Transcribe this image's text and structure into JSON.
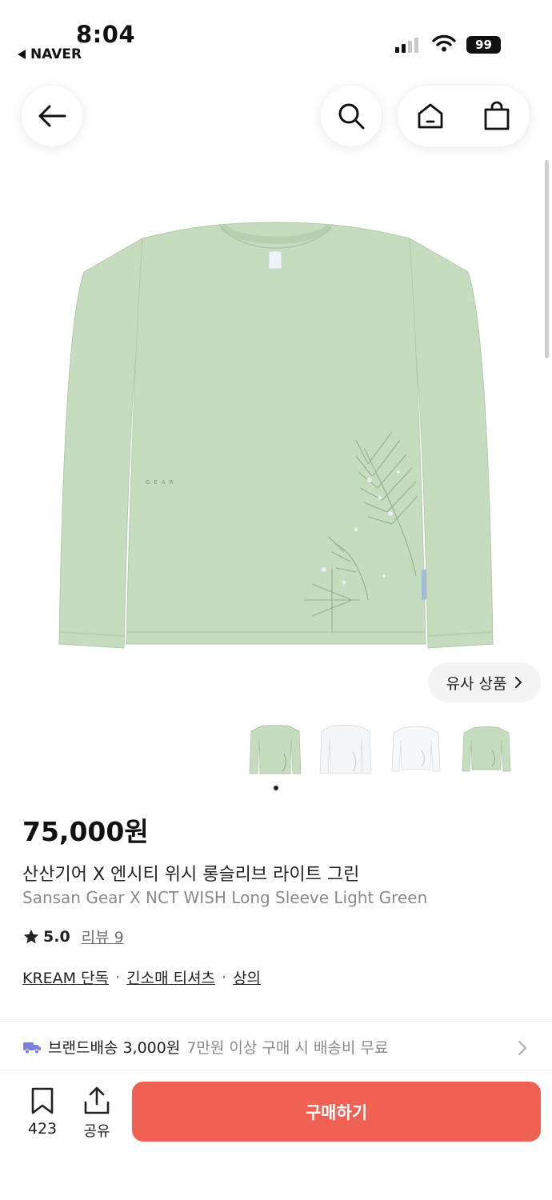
{
  "status_bar": {
    "time": "8:04",
    "back_app": "NAVER",
    "battery": "99"
  },
  "product": {
    "price": "75,000원",
    "name_ko": "산산기어 X 엔시티 위시 롱슬리브 라이트 그린",
    "name_en": "Sansan Gear X NCT WISH Long Sleeve Light Green",
    "rating": "5.0",
    "review_label": "리뷰 9",
    "colors": {
      "shirt_main": "#c6dcbe",
      "shirt_shade": "#b7cfaf",
      "shirt_white": "#f4f5f7"
    }
  },
  "similar_button": {
    "label": "유사 상품"
  },
  "categories": [
    {
      "label": "KREAM 단독"
    },
    {
      "label": "긴소매 티셔츠"
    },
    {
      "label": "상의"
    }
  ],
  "category_separator": "·",
  "shipping": {
    "label": "브랜드배송 3,000원",
    "note": "7만원 이상 구매 시 배송비 무료"
  },
  "bottom_bar": {
    "bookmark_count": "423",
    "share_label": "공유",
    "buy_label": "구매하기",
    "buy_color": "#ef6253"
  },
  "icons": {
    "nav": [
      "arrow-left-icon",
      "search-icon",
      "home-icon",
      "shopping-bag-icon"
    ],
    "bottom": [
      "bookmark-icon",
      "share-icon"
    ],
    "shipping": "truck-icon"
  }
}
